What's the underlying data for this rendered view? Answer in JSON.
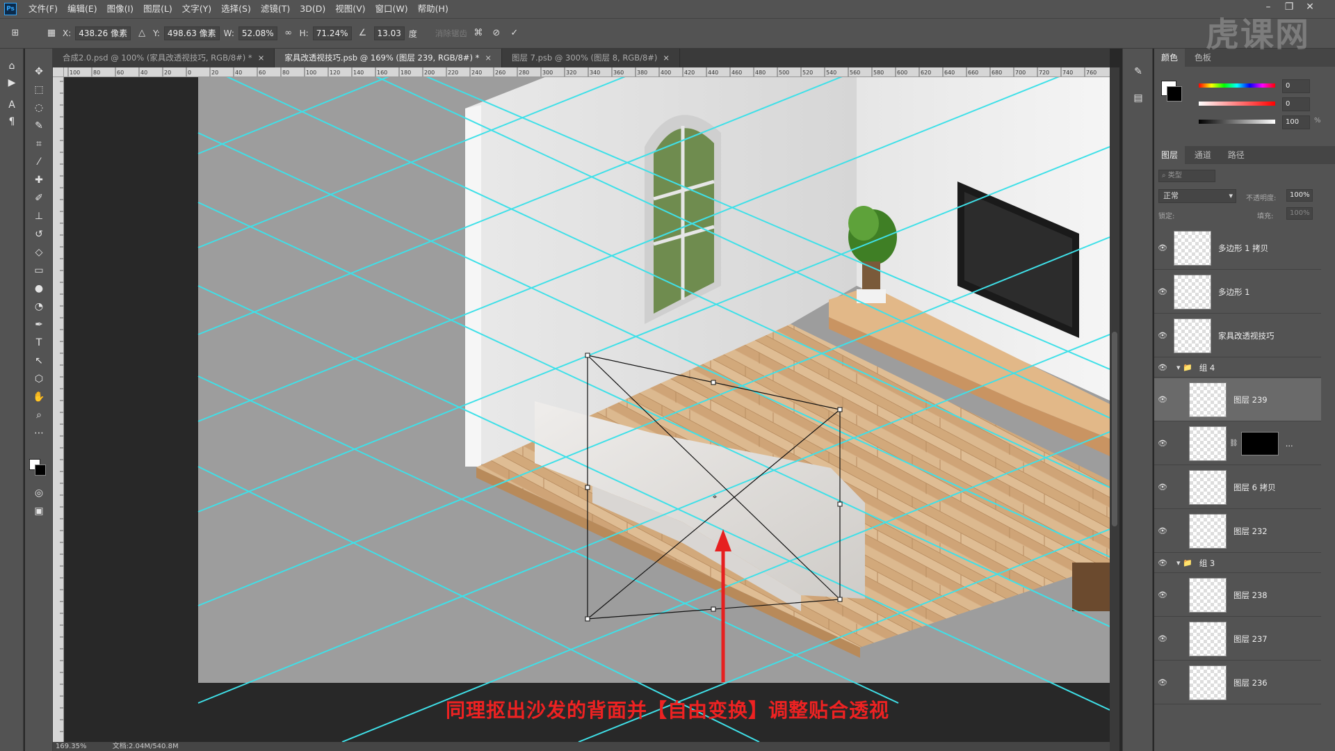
{
  "app": {
    "logo": "Ps",
    "window_controls": [
      "–",
      "❐",
      "✕"
    ]
  },
  "menu": [
    "文件(F)",
    "编辑(E)",
    "图像(I)",
    "图层(L)",
    "文字(Y)",
    "选择(S)",
    "滤镜(T)",
    "3D(D)",
    "视图(V)",
    "窗口(W)",
    "帮助(H)"
  ],
  "options": {
    "x_label": "X:",
    "x_value": "438.26 像素",
    "y_label": "Y:",
    "y_value": "498.63 像素",
    "w_label": "W:",
    "w_value": "52.08%",
    "h_label": "H:",
    "h_value": "71.24%",
    "angle_value": "13.03",
    "angle_unit": "度",
    "interp_label": "消除锯齿"
  },
  "tabs": [
    {
      "label": "合成2.0.psd @ 100% (家具改透视技巧, RGB/8#) *"
    },
    {
      "label": "家具改透视技巧.psb @ 169% (图层 239, RGB/8#) *"
    },
    {
      "label": "图层 7.psb @ 300% (图层 8, RGB/8#)"
    }
  ],
  "ruler_top": [
    "100",
    "80",
    "60",
    "40",
    "20",
    "0",
    "20",
    "40",
    "60",
    "80",
    "100",
    "120",
    "140",
    "160",
    "180",
    "200",
    "220",
    "240",
    "260",
    "280",
    "300",
    "320",
    "340",
    "360",
    "380",
    "400",
    "420",
    "440",
    "460",
    "480",
    "500",
    "520",
    "540",
    "560",
    "580",
    "600",
    "620",
    "640",
    "660",
    "680",
    "700",
    "720",
    "740",
    "760"
  ],
  "status": {
    "zoom": "169.35%",
    "doc": "文档:2.04M/540.8M"
  },
  "color_panel": {
    "tabs": [
      "颜色",
      "色板"
    ],
    "h_value": "0",
    "s_value": "0",
    "b_value": "100",
    "unit": "%"
  },
  "layers_panel": {
    "tabs": [
      "图层",
      "通道",
      "路径"
    ],
    "filter_placeholder": "类型",
    "blend_mode": "正常",
    "opacity_label": "不透明度:",
    "opacity_value": "100%",
    "lock_label": "锁定:",
    "fill_label": "填充:",
    "fill_value": "100%",
    "layers": [
      {
        "name": "多边形 1 拷贝",
        "kind": "layer"
      },
      {
        "name": "多边形 1",
        "kind": "layer"
      },
      {
        "name": "家具改透视技巧",
        "kind": "layer"
      },
      {
        "name": "组 4",
        "kind": "group"
      },
      {
        "name": "图层 239",
        "kind": "layer",
        "selected": true
      },
      {
        "name": "",
        "kind": "masked",
        "extra": "..."
      },
      {
        "name": "图层 6 拷贝",
        "kind": "layer"
      },
      {
        "name": "图层 232",
        "kind": "layer"
      },
      {
        "name": "组 3",
        "kind": "group"
      },
      {
        "name": "图层 238",
        "kind": "layer"
      },
      {
        "name": "图层 237",
        "kind": "layer"
      },
      {
        "name": "图层 236",
        "kind": "layer"
      }
    ]
  },
  "subtitle": "同理抠出沙发的背面并【自由变换】调整贴合透视",
  "watermark": "虎课网",
  "colors": {
    "guide_line": "#3fe0e8",
    "arrow": "#e62020",
    "subtitle": "#ee2222"
  }
}
